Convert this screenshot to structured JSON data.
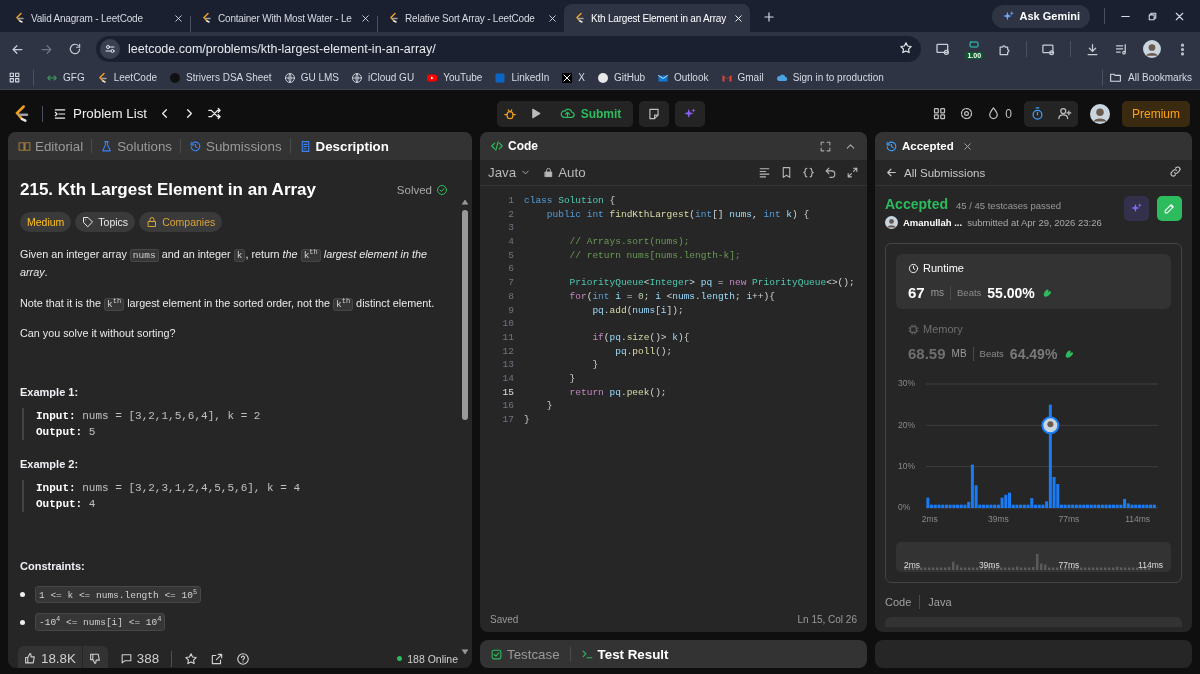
{
  "browser": {
    "tabs": [
      {
        "title": "Valid Anagram - LeetCode",
        "selected": false
      },
      {
        "title": "Container With Most Water - Le",
        "selected": false
      },
      {
        "title": "Relative Sort Array - LeetCode",
        "selected": false
      },
      {
        "title": "Kth Largest Element in an Array",
        "selected": true
      }
    ],
    "ask_button": "Ask Gemini",
    "url": "leetcode.com/problems/kth-largest-element-in-an-array/",
    "extension_badge": "1.00",
    "bookmarks": [
      {
        "label": "GFG"
      },
      {
        "label": "LeetCode"
      },
      {
        "label": "Strivers DSA Sheet"
      },
      {
        "label": "GU LMS"
      },
      {
        "label": "iCloud GU"
      },
      {
        "label": "YouTube"
      },
      {
        "label": "LinkedIn"
      },
      {
        "label": "X"
      },
      {
        "label": "GitHub"
      },
      {
        "label": "Outlook"
      },
      {
        "label": "Gmail"
      },
      {
        "label": "Sign in to production"
      }
    ],
    "all_bookmarks": "All Bookmarks"
  },
  "navbar": {
    "problem_list": "Problem List",
    "submit": "Submit",
    "streak": "0",
    "premium": "Premium"
  },
  "description": {
    "tabs": [
      {
        "label": "Editorial",
        "selected": false
      },
      {
        "label": "Solutions",
        "selected": false
      },
      {
        "label": "Submissions",
        "selected": false
      },
      {
        "label": "Description",
        "selected": true
      }
    ],
    "title": "215. Kth Largest Element in an Array",
    "status": "Solved",
    "tags": [
      {
        "label": "Medium",
        "kind": "difficulty"
      },
      {
        "label": "Topics",
        "kind": "topics"
      },
      {
        "label": "Companies",
        "kind": "companies"
      }
    ],
    "paragraphs": [
      [
        {
          "text": "Given an integer array ",
          "kind": "text"
        },
        {
          "text": "nums",
          "kind": "code"
        },
        {
          "text": " and an integer ",
          "kind": "text"
        },
        {
          "text": "k",
          "kind": "code"
        },
        {
          "text": ", return ",
          "kind": "text"
        },
        {
          "text": "the ",
          "kind": "em"
        },
        {
          "text": "k$^{th}$",
          "kind": "code"
        },
        {
          "text": " largest element in the array",
          "kind": "em"
        },
        {
          "text": ".",
          "kind": "text"
        }
      ],
      [
        {
          "text": "Note that it is the ",
          "kind": "text"
        },
        {
          "text": "k$^{th}$",
          "kind": "code"
        },
        {
          "text": " largest element in the sorted order, not the ",
          "kind": "text"
        },
        {
          "text": "k$^{th}$",
          "kind": "code"
        },
        {
          "text": " distinct element.",
          "kind": "text"
        }
      ],
      [
        {
          "text": "Can you solve it without sorting?",
          "kind": "text"
        }
      ]
    ],
    "examples": [
      {
        "heading": "Example 1:",
        "input_label": "Input:",
        "input": "nums = [3,2,1,5,6,4], k = 2",
        "output_label": "Output:",
        "output": "5"
      },
      {
        "heading": "Example 2:",
        "input_label": "Input:",
        "input": "nums = [3,2,3,1,2,4,5,5,6], k = 4",
        "output_label": "Output:",
        "output": "4"
      }
    ],
    "constraints_heading": "Constraints:",
    "constraints": [
      "1 <= k <= nums.length <= 10$^{5}$",
      "-10$^{4}$ <= nums[i] <= 10$^{4}$"
    ],
    "footer": {
      "likes": "18.8K",
      "comments": "388",
      "online": "188 Online"
    }
  },
  "editor": {
    "title": "Code",
    "language": "Java",
    "mode": "Auto",
    "lines": [
      {
        "num": "1",
        "active": false,
        "tokens": [
          {
            "text": "class",
            "kind": "keyword"
          },
          {
            "text": " Solution",
            "kind": "type"
          },
          {
            "text": " {",
            "kind": "plain"
          }
        ]
      },
      {
        "num": "2",
        "active": false,
        "tokens": [
          {
            "text": "    public",
            "kind": "keyword"
          },
          {
            "text": " int",
            "kind": "keyword"
          },
          {
            "text": " findKthLargest",
            "kind": "function"
          },
          {
            "text": "(",
            "kind": "plain"
          },
          {
            "text": "int",
            "kind": "keyword"
          },
          {
            "text": "[] ",
            "kind": "plain"
          },
          {
            "text": "nums",
            "kind": "variable"
          },
          {
            "text": ", ",
            "kind": "plain"
          },
          {
            "text": "int",
            "kind": "keyword"
          },
          {
            "text": " k",
            "kind": "variable"
          },
          {
            "text": ") {",
            "kind": "plain"
          }
        ]
      },
      {
        "num": "3",
        "active": false
      },
      {
        "num": "4",
        "active": false,
        "tokens": [
          {
            "text": "        // Arrays.sort(nums);",
            "kind": "comment"
          }
        ]
      },
      {
        "num": "5",
        "active": false,
        "tokens": [
          {
            "text": "        // return nums[nums.length-k];",
            "kind": "comment"
          }
        ]
      },
      {
        "num": "6",
        "active": false
      },
      {
        "num": "7",
        "active": false,
        "tokens": [
          {
            "text": "        PriorityQueue",
            "kind": "type"
          },
          {
            "text": "<",
            "kind": "plain"
          },
          {
            "text": "Integer",
            "kind": "type"
          },
          {
            "text": "> ",
            "kind": "plain"
          },
          {
            "text": "pq",
            "kind": "variable"
          },
          {
            "text": " = ",
            "kind": "plain"
          },
          {
            "text": "new",
            "kind": "control"
          },
          {
            "text": " PriorityQueue",
            "kind": "type"
          },
          {
            "text": "<>();",
            "kind": "plain"
          }
        ]
      },
      {
        "num": "8",
        "active": false,
        "tokens": [
          {
            "text": "        for",
            "kind": "control"
          },
          {
            "text": "(",
            "kind": "plain"
          },
          {
            "text": "int",
            "kind": "keyword"
          },
          {
            "text": " i",
            "kind": "variable"
          },
          {
            "text": " = ",
            "kind": "plain"
          },
          {
            "text": "0",
            "kind": "number"
          },
          {
            "text": "; ",
            "kind": "plain"
          },
          {
            "text": "i",
            "kind": "variable"
          },
          {
            "text": " <",
            "kind": "plain"
          },
          {
            "text": "nums",
            "kind": "variable"
          },
          {
            "text": ".",
            "kind": "plain"
          },
          {
            "text": "length",
            "kind": "variable"
          },
          {
            "text": "; ",
            "kind": "plain"
          },
          {
            "text": "i",
            "kind": "variable"
          },
          {
            "text": "++){",
            "kind": "plain"
          }
        ]
      },
      {
        "num": "9",
        "active": false,
        "tokens": [
          {
            "text": "            pq",
            "kind": "variable"
          },
          {
            "text": ".",
            "kind": "plain"
          },
          {
            "text": "add",
            "kind": "function"
          },
          {
            "text": "(",
            "kind": "plain"
          },
          {
            "text": "nums",
            "kind": "variable"
          },
          {
            "text": "[",
            "kind": "plain"
          },
          {
            "text": "i",
            "kind": "variable"
          },
          {
            "text": "]);",
            "kind": "plain"
          }
        ]
      },
      {
        "num": "10",
        "active": false
      },
      {
        "num": "11",
        "active": false,
        "tokens": [
          {
            "text": "            if",
            "kind": "control"
          },
          {
            "text": "(",
            "kind": "plain"
          },
          {
            "text": "pq",
            "kind": "variable"
          },
          {
            "text": ".",
            "kind": "plain"
          },
          {
            "text": "size",
            "kind": "function"
          },
          {
            "text": "()> ",
            "kind": "plain"
          },
          {
            "text": "k",
            "kind": "variable"
          },
          {
            "text": "){",
            "kind": "plain"
          }
        ]
      },
      {
        "num": "12",
        "active": false,
        "tokens": [
          {
            "text": "                pq",
            "kind": "variable"
          },
          {
            "text": ".",
            "kind": "plain"
          },
          {
            "text": "poll",
            "kind": "function"
          },
          {
            "text": "();",
            "kind": "plain"
          }
        ]
      },
      {
        "num": "13",
        "active": false,
        "tokens": [
          {
            "text": "            }",
            "kind": "plain"
          }
        ]
      },
      {
        "num": "14",
        "active": false,
        "tokens": [
          {
            "text": "        }",
            "kind": "plain"
          }
        ]
      },
      {
        "num": "15",
        "active": true,
        "tokens": [
          {
            "text": "        return",
            "kind": "control"
          },
          {
            "text": " pq",
            "kind": "variable"
          },
          {
            "text": ".",
            "kind": "plain"
          },
          {
            "text": "peek",
            "kind": "function"
          },
          {
            "text": "();",
            "kind": "plain"
          }
        ]
      },
      {
        "num": "16",
        "active": false,
        "tokens": [
          {
            "text": "    }",
            "kind": "plain"
          }
        ]
      },
      {
        "num": "17",
        "active": false,
        "tokens": [
          {
            "text": "}",
            "kind": "plain"
          }
        ]
      }
    ],
    "status": "Saved",
    "cursor": "Ln 15, Col 26"
  },
  "console_tabs": [
    {
      "label": "Testcase",
      "selected": false
    },
    {
      "label": "Test Result",
      "selected": true
    }
  ],
  "submission": {
    "tab": "Accepted",
    "back_link": "All Submissions",
    "verdict": "Accepted",
    "testcases": "45 / 45 testcases passed",
    "author": "Amanullah ...",
    "submitted": "submitted at Apr 29, 2026 23:26",
    "metrics": [
      {
        "label": "Runtime",
        "value": "67",
        "unit": "ms",
        "beats_label": "Beats",
        "beats": "55.00%",
        "selected": true
      },
      {
        "label": "Memory",
        "value": "68.59",
        "unit": "MB",
        "beats_label": "Beats",
        "beats": "64.49%",
        "selected": false
      }
    ],
    "chart_data": {
      "type": "bar",
      "x": [
        1,
        3,
        5,
        7,
        9,
        11,
        13,
        15,
        17,
        19,
        21,
        23,
        25,
        27,
        29,
        31,
        33,
        35,
        37,
        39,
        41,
        43,
        45,
        47,
        49,
        51,
        53,
        55,
        57,
        59,
        61,
        63,
        65,
        67,
        69,
        71,
        73,
        75,
        77,
        79,
        81,
        83,
        85,
        87,
        89,
        91,
        93,
        95,
        97,
        99,
        101,
        103,
        105,
        107,
        109,
        111,
        113,
        115,
        117,
        119,
        121,
        123
      ],
      "values": [
        2.5,
        0.8,
        0.8,
        0.8,
        0.8,
        0.8,
        0.8,
        0.8,
        0.8,
        0.8,
        0.8,
        1.5,
        10.5,
        5.5,
        0.8,
        0.8,
        0.8,
        0.8,
        0.8,
        0.8,
        2.5,
        3.2,
        3.7,
        0.8,
        0.8,
        0.8,
        0.8,
        0.8,
        2.4,
        0.8,
        0.8,
        0.8,
        1.6,
        25,
        7.5,
        5.8,
        0.8,
        0.8,
        0.8,
        0.8,
        0.8,
        0.8,
        0.8,
        0.8,
        0.8,
        0.8,
        0.8,
        0.8,
        0.8,
        0.8,
        0.8,
        0.8,
        0.8,
        2.2,
        1.1,
        0.8,
        0.8,
        0.8,
        0.8,
        0.8,
        0.8,
        0.8
      ],
      "xlim": [
        0,
        125
      ],
      "ylim": [
        0,
        30
      ],
      "xticks": [
        {
          "value": 2,
          "label": "2ms"
        },
        {
          "value": 39,
          "label": "39ms"
        },
        {
          "value": 77,
          "label": "77ms"
        },
        {
          "value": 114,
          "label": "114ms"
        }
      ],
      "yticks": [
        {
          "value": 0,
          "label": "0%"
        },
        {
          "value": 10,
          "label": "10%"
        },
        {
          "value": 20,
          "label": "20%"
        },
        {
          "value": 30,
          "label": "30%"
        }
      ]
    },
    "range_labels": [
      "2ms",
      "39ms",
      "77ms",
      "114ms"
    ],
    "code_label": "Code",
    "code_language": "Java"
  }
}
